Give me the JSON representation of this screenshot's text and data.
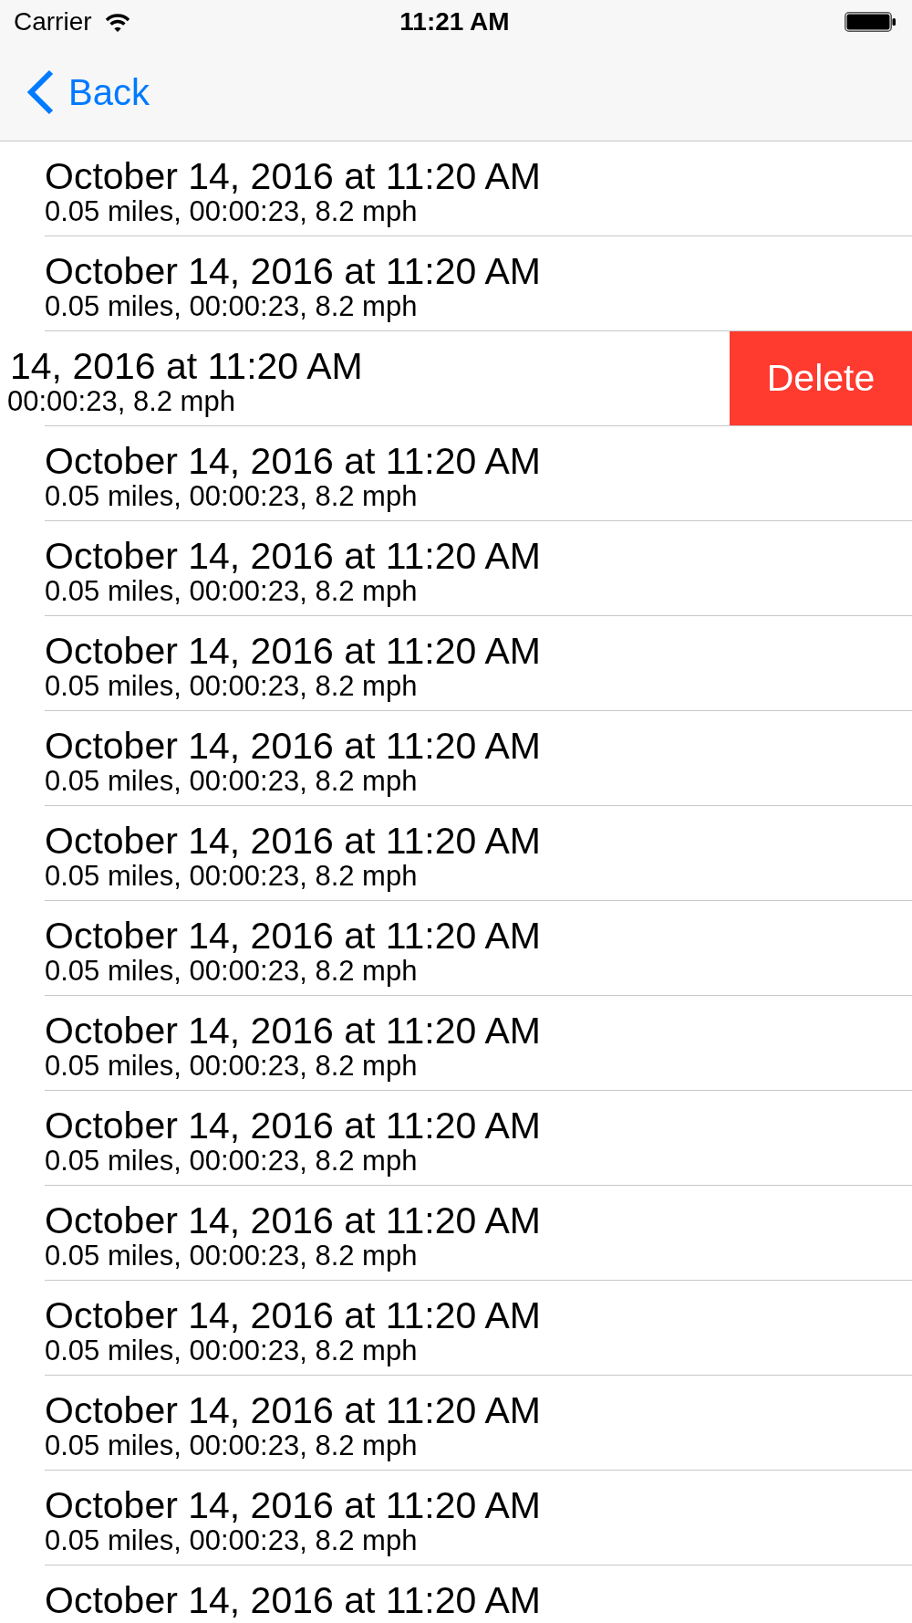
{
  "status_bar": {
    "carrier": "Carrier",
    "time": "11:21 AM"
  },
  "nav_bar": {
    "back": "Back"
  },
  "rows": [
    {
      "title": "October 14, 2016 at 11:20 AM",
      "detail": "0.05 miles, 00:00:23, 8.2 mph"
    },
    {
      "title": "October 14, 2016 at 11:20 AM",
      "detail": "0.05 miles, 00:00:23, 8.2 mph"
    },
    {
      "title": "14, 2016 at 11:20 AM",
      "detail": "00:00:23, 8.2 mph",
      "action": "Delete"
    },
    {
      "title": "October 14, 2016 at 11:20 AM",
      "detail": "0.05 miles, 00:00:23, 8.2 mph"
    },
    {
      "title": "October 14, 2016 at 11:20 AM",
      "detail": "0.05 miles, 00:00:23, 8.2 mph"
    },
    {
      "title": "October 14, 2016 at 11:20 AM",
      "detail": "0.05 miles, 00:00:23, 8.2 mph"
    },
    {
      "title": "October 14, 2016 at 11:20 AM",
      "detail": "0.05 miles, 00:00:23, 8.2 mph"
    },
    {
      "title": "October 14, 2016 at 11:20 AM",
      "detail": "0.05 miles, 00:00:23, 8.2 mph"
    },
    {
      "title": "October 14, 2016 at 11:20 AM",
      "detail": "0.05 miles, 00:00:23, 8.2 mph"
    },
    {
      "title": "October 14, 2016 at 11:20 AM",
      "detail": "0.05 miles, 00:00:23, 8.2 mph"
    },
    {
      "title": "October 14, 2016 at 11:20 AM",
      "detail": "0.05 miles, 00:00:23, 8.2 mph"
    },
    {
      "title": "October 14, 2016 at 11:20 AM",
      "detail": "0.05 miles, 00:00:23, 8.2 mph"
    },
    {
      "title": "October 14, 2016 at 11:20 AM",
      "detail": "0.05 miles, 00:00:23, 8.2 mph"
    },
    {
      "title": "October 14, 2016 at 11:20 AM",
      "detail": "0.05 miles, 00:00:23, 8.2 mph"
    },
    {
      "title": "October 14, 2016 at 11:20 AM",
      "detail": "0.05 miles, 00:00:23, 8.2 mph"
    },
    {
      "title": "October 14, 2016 at 11:20 AM"
    }
  ]
}
